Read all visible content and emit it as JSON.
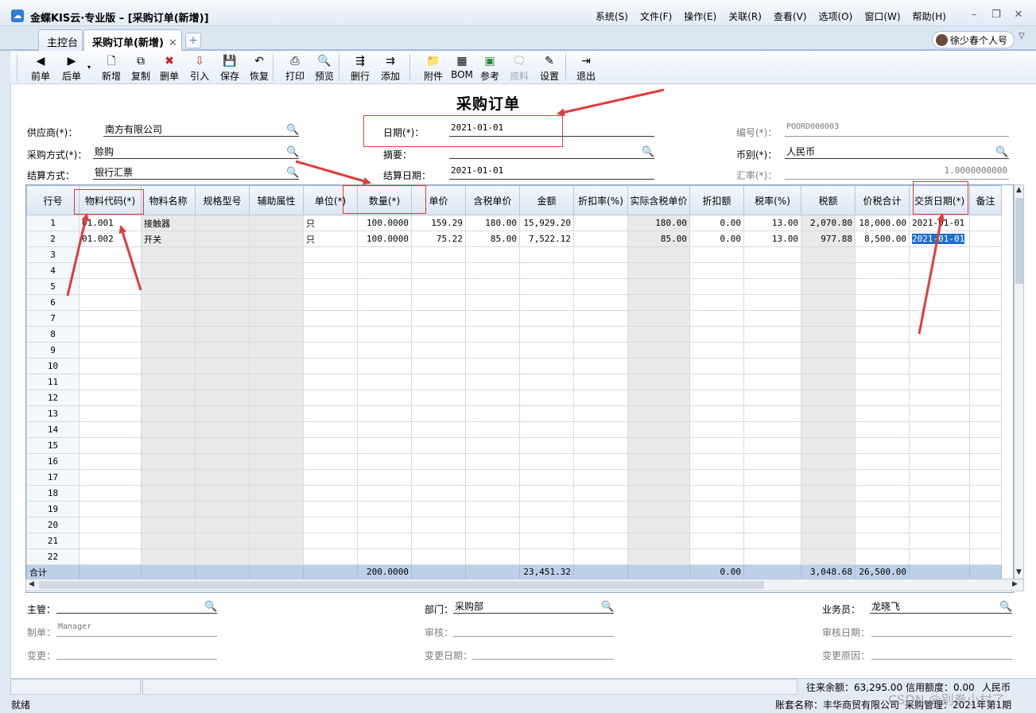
{
  "window": {
    "title": "金蝶KIS云·专业版 – [采购订单(新增)]",
    "logo": "cloud-logo"
  },
  "menu": [
    "系统(S)",
    "文件(F)",
    "操作(E)",
    "关联(R)",
    "查看(V)",
    "选项(O)",
    "窗口(W)",
    "帮助(H)"
  ],
  "window_controls": {
    "minimize": "–",
    "restore": "❐",
    "close": "✕"
  },
  "tabs": [
    {
      "label": "主控台"
    },
    {
      "label": "采购订单(新增)",
      "close": "✕"
    }
  ],
  "tab_add": "+",
  "user": {
    "name": "徐少春个人号"
  },
  "toolbar": [
    {
      "label": "前单",
      "icon": "◀",
      "name": "prev-doc"
    },
    {
      "label": "后单",
      "icon": "▶",
      "name": "next-doc"
    },
    {
      "label": "新增",
      "icon": "🗋",
      "name": "new"
    },
    {
      "label": "复制",
      "icon": "⧉",
      "name": "copy"
    },
    {
      "label": "删单",
      "icon": "✖",
      "name": "delete-doc",
      "color": "#d81c1c"
    },
    {
      "label": "引入",
      "icon": "⇩",
      "name": "import",
      "color": "#d81c1c"
    },
    {
      "label": "保存",
      "icon": "💾",
      "name": "save"
    },
    {
      "label": "恢复",
      "icon": "↶",
      "name": "restore"
    },
    {
      "label": "打印",
      "icon": "⎙",
      "name": "print"
    },
    {
      "label": "预览",
      "icon": "🔍",
      "name": "preview"
    },
    {
      "label": "删行",
      "icon": "⇶",
      "name": "delete-row"
    },
    {
      "label": "添加",
      "icon": "⇉",
      "name": "add-row"
    },
    {
      "label": "附件",
      "icon": "📁",
      "name": "attachment"
    },
    {
      "label": "BOM",
      "icon": "▦",
      "name": "bom"
    },
    {
      "label": "参考",
      "icon": "▣",
      "name": "reference",
      "color": "#2e8b3a"
    },
    {
      "label": "资料",
      "icon": "🗨",
      "name": "data",
      "disabled": true
    },
    {
      "label": "设置",
      "icon": "✎",
      "name": "settings"
    },
    {
      "label": "退出",
      "icon": "⇥",
      "name": "exit"
    }
  ],
  "doc_title": "采购订单",
  "header": {
    "supplier": {
      "label": "供应商(*)：",
      "value": "南方有限公司"
    },
    "purchase_method": {
      "label": "采购方式(*)：",
      "value": "赊购"
    },
    "settle_method": {
      "label": "结算方式：",
      "value": "银行汇票"
    },
    "date": {
      "label": "日期(*)：",
      "value": "2021-01-01"
    },
    "summary": {
      "label": "摘要：",
      "value": ""
    },
    "settle_date": {
      "label": "结算日期：",
      "value": "2021-01-01"
    },
    "number": {
      "label": "编号(*)：",
      "value": "POORD000003"
    },
    "currency": {
      "label": "币别(*)：",
      "value": "人民币"
    },
    "rate": {
      "label": "汇率(*)：",
      "value": "1.0000000000"
    }
  },
  "grid": {
    "columns": [
      "行号",
      "物料代码(*)",
      "物料名称",
      "规格型号",
      "辅助属性",
      "单位(*)",
      "数量(*)",
      "单价",
      "含税单价",
      "金额",
      "折扣率(%)",
      "实际含税单价",
      "折扣额",
      "税率(%)",
      "税额",
      "价税合计",
      "交货日期(*)",
      "备注"
    ],
    "rows": [
      [
        "1",
        "01.001",
        "接触器",
        "",
        "",
        "只",
        "100.0000",
        "159.29",
        "180.00",
        "15,929.20",
        "",
        "180.00",
        "0.00",
        "13.00",
        "2,070.80",
        "18,000.00",
        "2021-01-01",
        ""
      ],
      [
        "2",
        "01.002",
        "开关",
        "",
        "",
        "只",
        "100.0000",
        "75.22",
        "85.00",
        "7,522.12",
        "",
        "85.00",
        "0.00",
        "13.00",
        "977.88",
        "8,500.00",
        "2021-01-01",
        ""
      ],
      [
        "3"
      ],
      [
        "4"
      ],
      [
        "5"
      ],
      [
        "6"
      ],
      [
        "7"
      ],
      [
        "8"
      ],
      [
        "9"
      ],
      [
        "10"
      ],
      [
        "11"
      ],
      [
        "12"
      ],
      [
        "13"
      ],
      [
        "14"
      ],
      [
        "15"
      ],
      [
        "16"
      ],
      [
        "17"
      ],
      [
        "18"
      ],
      [
        "19"
      ],
      [
        "20"
      ],
      [
        "21"
      ],
      [
        "22"
      ]
    ],
    "total": {
      "label": "合计",
      "qty": "200.0000",
      "amount": "23,451.32",
      "discount": "0.00",
      "tax": "3,048.68",
      "total": "26,500.00"
    }
  },
  "footer": {
    "manager": {
      "label": "主管：",
      "value": ""
    },
    "dept": {
      "label": "部门：",
      "value": "采购部"
    },
    "clerk": {
      "label": "业务员：",
      "value": "龙晓飞"
    },
    "maker": {
      "label": "制单：",
      "value": "Manager"
    },
    "auditor": {
      "label": "审核：",
      "value": ""
    },
    "audit_date": {
      "label": "审核日期：",
      "value": ""
    },
    "changer": {
      "label": "变更：",
      "value": ""
    },
    "change_date": {
      "label": "变更日期：",
      "value": ""
    },
    "change_reason": {
      "label": "变更原因：",
      "value": ""
    }
  },
  "status": {
    "ready": "就绪",
    "balance": "往来余额：63,295.00",
    "credit": "信用额度：0.00",
    "currency": "人民币",
    "account": "账套名称：丰华商贸有限公司",
    "module": "采购管理：2021年第1期"
  },
  "watermark": "CSDN @别拳小村了",
  "colors": {
    "annotation": "#e23b3b",
    "selection": "#1e6fd0",
    "header_bg": "#dbe6f3",
    "total_bg": "#bdd0e8"
  }
}
